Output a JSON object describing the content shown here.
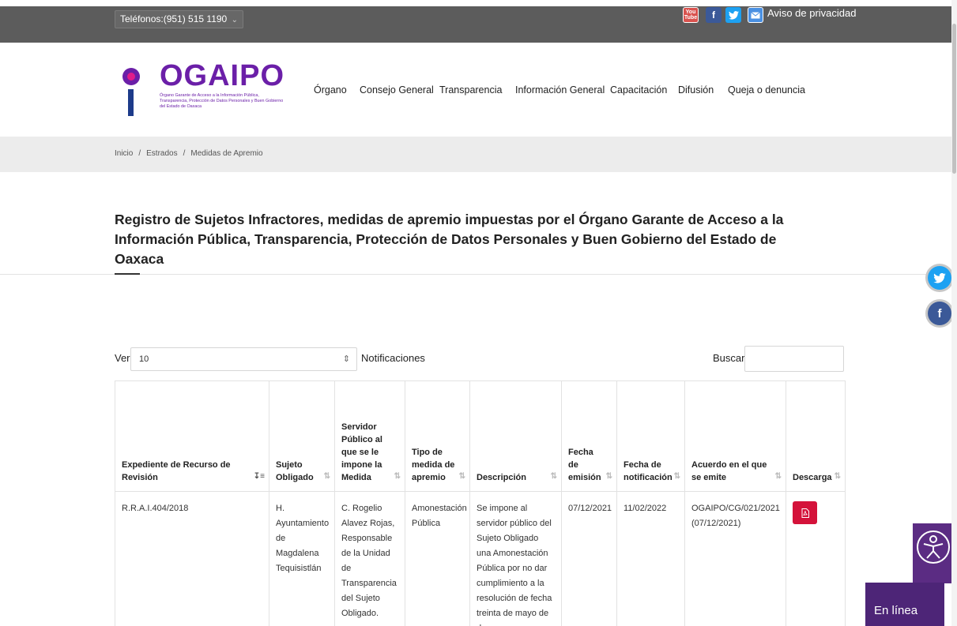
{
  "topbar": {
    "phone": "Teléfonos:(951) 515 1190",
    "social": {
      "youtube": "You\nTube",
      "facebook": "f",
      "twitter": "t"
    },
    "privacy": "Aviso de privacidad"
  },
  "logo": {
    "name": "OGAIPO",
    "subtitle": "Órgano Garante de Acceso a la Información Pública, Transparencia, Protección de Datos Personales y Buen Gobierno del Estado de Oaxaca"
  },
  "nav": [
    "Órgano",
    "Consejo General",
    "Transparencia",
    "Información General",
    "Capacitación",
    "Difusión",
    "Queja o denuncia"
  ],
  "breadcrumb": [
    "Inicio",
    "Estrados",
    "Medidas de Apremio"
  ],
  "page_title": "Registro de Sujetos Infractores, medidas de apremio impuestas por el Órgano Garante de Acceso a la Información Pública, Transparencia, Protección de Datos Personales y Buen Gobierno del Estado de Oaxaca",
  "controls": {
    "ver_label": "Ver",
    "page_size": "10",
    "notificaciones_label": "Notificaciones",
    "buscar_label": "Buscar",
    "search_value": ""
  },
  "table": {
    "columns": [
      "Expediente de Recurso de Revisión",
      "Sujeto Obligado",
      "Servidor Público al que se le impone la Medida",
      "Tipo de medida de apremio",
      "Descripción",
      "Fecha de emisión",
      "Fecha de notificación",
      "Acuerdo en el que se emite",
      "Descarga"
    ],
    "rows": [
      {
        "expediente": "R.R.A.I.404/2018",
        "sujeto": "H. Ayuntamiento de Magdalena Tequisistlán",
        "servidor": "C. Rogelio Alavez Rojas, Responsable de la Unidad de Transparencia del Sujeto Obligado.",
        "tipo": "Amonestación Pública",
        "descripcion": "Se impone al servidor público del Sujeto Obligado una Amonestación Pública por no dar cumplimiento a la resolución de fecha treinta de mayo de dos",
        "emision": "07/12/2021",
        "notificacion": "11/02/2022",
        "acuerdo": "OGAIPO/CG/021/2021 (07/12/2021)"
      }
    ]
  },
  "widgets": {
    "en_linea": "En línea"
  },
  "colors": {
    "topbar": "#5c5c5c",
    "brand_purple": "#6b1fa8",
    "pdf_red": "#d4123a",
    "chat_purple": "#4d2577"
  }
}
